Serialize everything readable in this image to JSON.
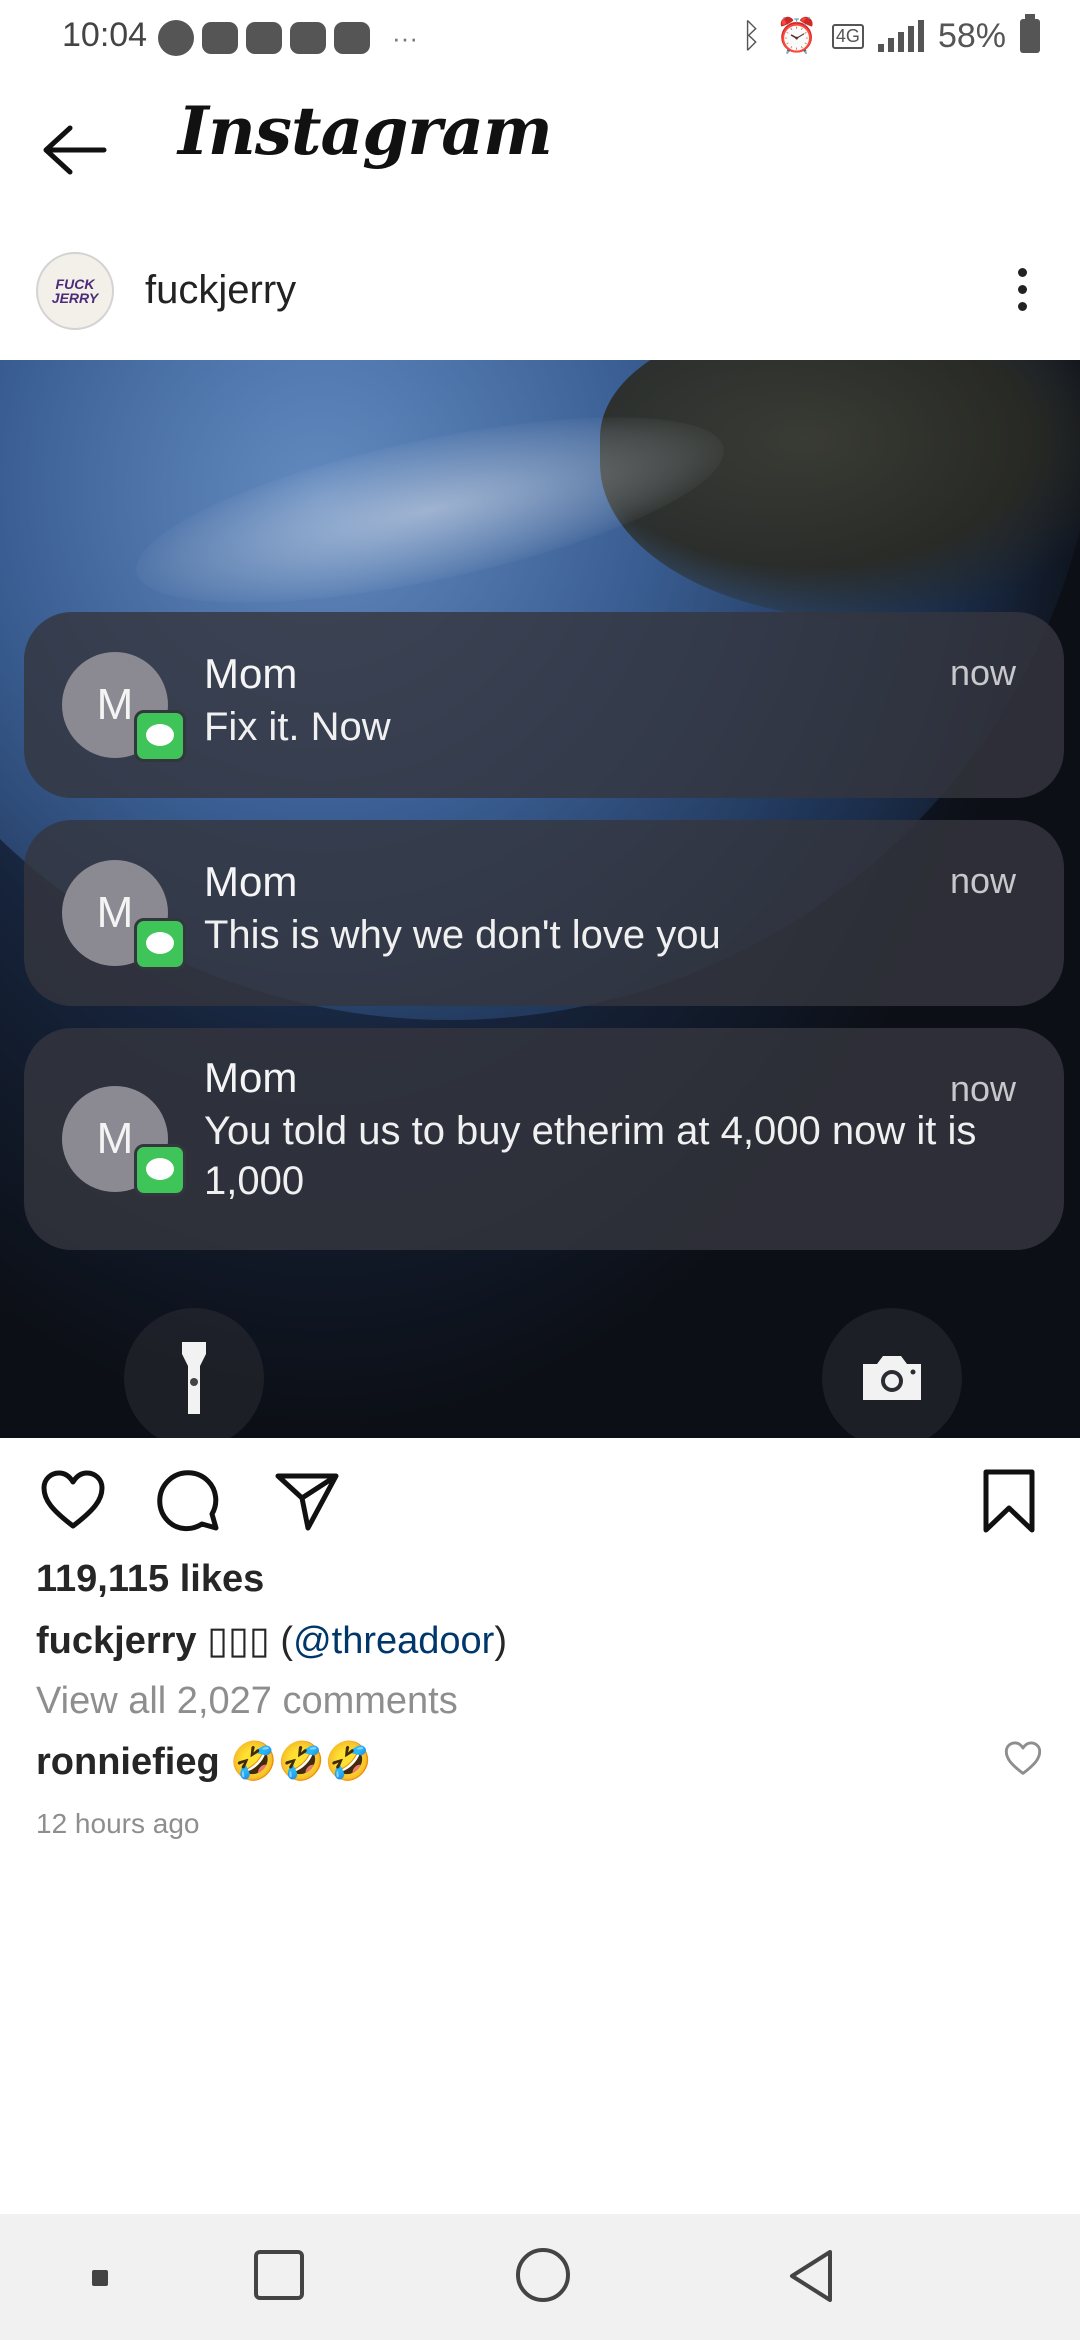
{
  "status_bar": {
    "time": "10:04",
    "network": "4G",
    "battery": "58%"
  },
  "header": {
    "title": "Instagram"
  },
  "post": {
    "username": "fuckjerry",
    "avatar_text": "FUCK JERRY",
    "image": {
      "notifications": [
        {
          "sender": "Mom",
          "time": "now",
          "avatar_letter": "M",
          "message": "Fix it. Now"
        },
        {
          "sender": "Mom",
          "time": "now",
          "avatar_letter": "M",
          "message": "This is why we don't love you"
        },
        {
          "sender": "Mom",
          "time": "now",
          "avatar_letter": "M",
          "message": "You told us to buy etherim at 4,000 now it is 1,000"
        }
      ]
    },
    "likes": "119,115 likes",
    "caption": {
      "user": "fuckjerry",
      "emoji": "▯▯▯",
      "open": " (",
      "mention": "@threadoor",
      "close": ")"
    },
    "view_comments": "View all 2,027 comments",
    "comment": {
      "user": "ronniefieg",
      "text": "🤣🤣🤣"
    },
    "timestamp": "12 hours ago"
  },
  "icons": {
    "back": "back-arrow-icon",
    "more": "more-vertical-icon",
    "like": "heart-icon",
    "comment": "comment-icon",
    "share": "send-icon",
    "save": "bookmark-icon"
  },
  "colors": {
    "mention": "#00376b",
    "muted": "#8e8e8e",
    "badge_green": "#3fc45a"
  }
}
